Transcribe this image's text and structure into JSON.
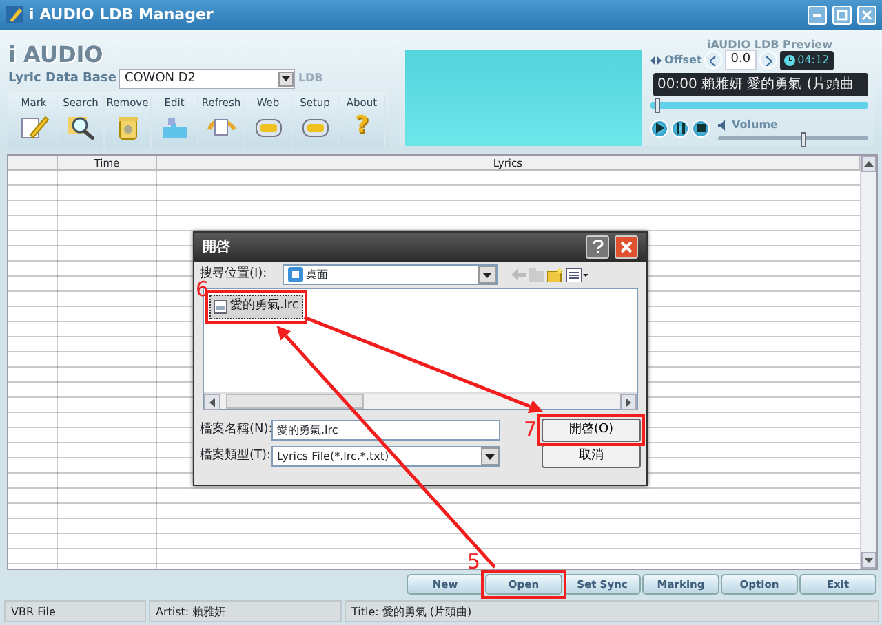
{
  "window": {
    "title": "i AUDIO LDB Manager"
  },
  "header": {
    "logo": "i AUDIO",
    "db_label": "Lyric Data Base",
    "db_value": "COWON D2",
    "db_badge": "LDB",
    "toolbar": [
      {
        "label": "Mark"
      },
      {
        "label": "Search"
      },
      {
        "label": "Remove"
      },
      {
        "label": "Edit"
      },
      {
        "label": "Refresh"
      },
      {
        "label": "Web"
      },
      {
        "label": "Setup"
      },
      {
        "label": "About",
        "icon_char": "?"
      }
    ]
  },
  "preview": {
    "title": "iAUDIO LDB Preview",
    "offset_label": "Offset",
    "offset_value": "0.0",
    "duration": "04:12",
    "lyric_line": "00:00 賴雅妍 愛的勇氣 (片頭曲",
    "seek": {
      "level": 0.02
    },
    "volume_label": "Volume",
    "volume": {
      "level": 0.55
    }
  },
  "table": {
    "columns": [
      "Time",
      "Lyrics"
    ]
  },
  "buttons": [
    "New",
    "Open",
    "Set Sync",
    "Marking",
    "Option",
    "Exit"
  ],
  "status_bar": [
    "VBR File",
    "Artist: 賴雅妍",
    "Title: 愛的勇氣 (片頭曲)"
  ],
  "dialog": {
    "title": "開啓",
    "look_in_label": "搜尋位置(I):",
    "look_in_value": "桌面",
    "files": [
      {
        "name": "愛的勇氣.lrc",
        "selected": true
      }
    ],
    "file_name_label": "檔案名稱(N):",
    "file_name_value": "愛的勇氣.lrc",
    "file_type_label": "檔案類型(T):",
    "file_type_value": "Lyrics File(*.lrc,*.txt)",
    "buttons": [
      "開啓(O)",
      "取消"
    ]
  },
  "annotations": [
    {
      "label": "5"
    },
    {
      "label": "6"
    },
    {
      "label": "7"
    }
  ]
}
